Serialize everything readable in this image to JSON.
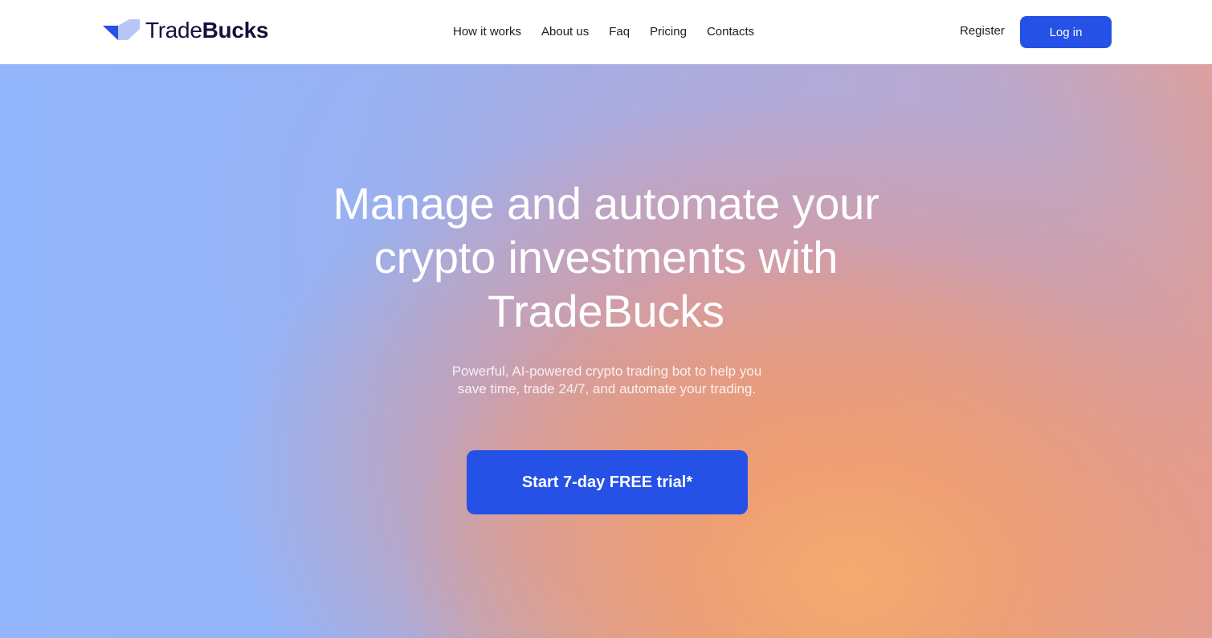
{
  "brand": {
    "name_light": "Trade",
    "name_bold": "Bucks",
    "colors": {
      "logo_dark": "#2551e6",
      "logo_light": "#b8c6f7",
      "text": "#14113a"
    }
  },
  "header": {
    "nav": [
      {
        "label": "How it works"
      },
      {
        "label": "About us"
      },
      {
        "label": "Faq"
      },
      {
        "label": "Pricing"
      },
      {
        "label": "Contacts"
      }
    ],
    "register_label": "Register",
    "login_label": "Log in"
  },
  "hero": {
    "headline_line1": "Manage and automate your",
    "headline_line2": "crypto investments with",
    "headline_line3": "TradeBucks",
    "subline": "Powerful, AI-powered crypto trading bot to help you save time, trade 24/7, and automate your trading.",
    "cta_label": "Start 7-day FREE trial*"
  },
  "colors": {
    "accent": "#2551e6",
    "gradient_blue": "#93b5fb",
    "gradient_orange": "#f2a86f"
  }
}
